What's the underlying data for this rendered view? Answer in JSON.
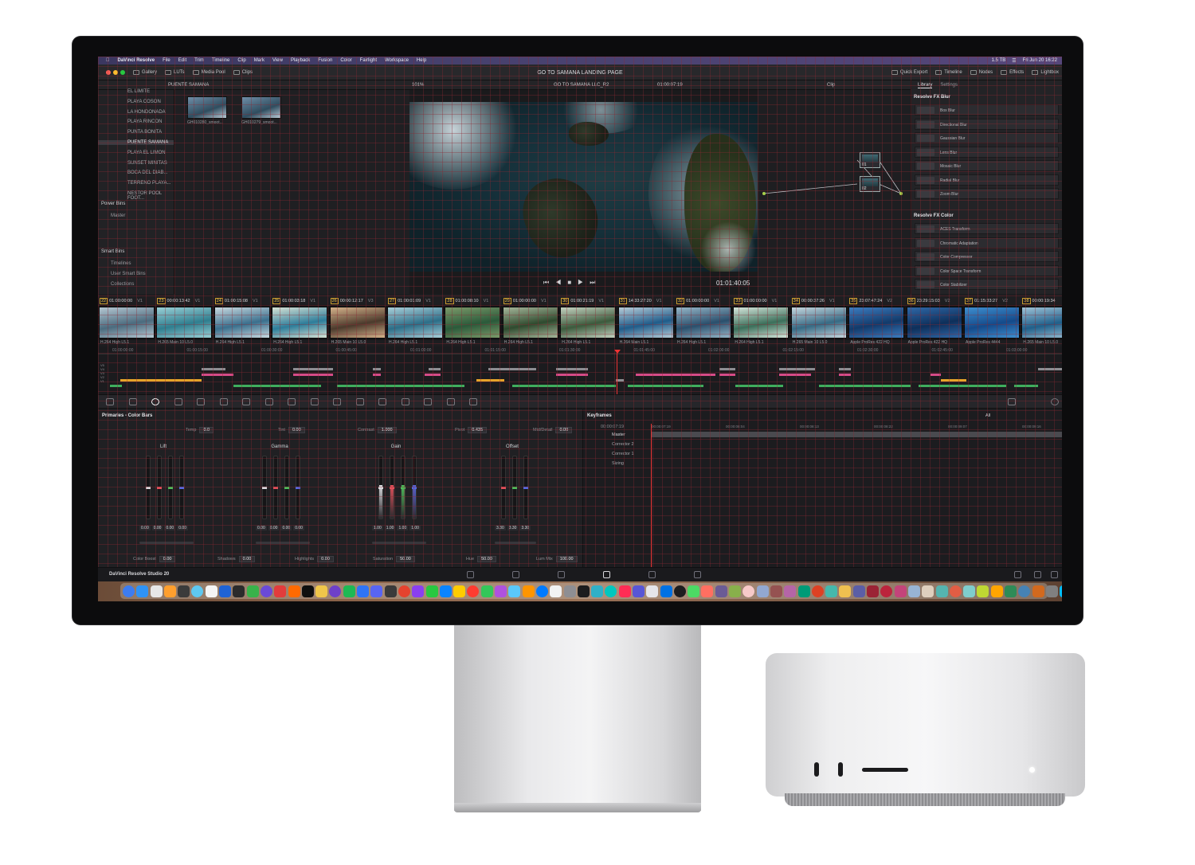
{
  "menubar": {
    "app": "DaVinci Resolve",
    "items": [
      "File",
      "Edit",
      "Trim",
      "Timeline",
      "Clip",
      "Mark",
      "View",
      "Playback",
      "Fusion",
      "Color",
      "Fairlight",
      "Workspace",
      "Help"
    ],
    "storage": "1.5 TB",
    "clock": "Fri Jun 20  16:22"
  },
  "toolbar": {
    "gallery": "Gallery",
    "luts": "LUTs",
    "media_pool": "Media Pool",
    "clips": "Clips",
    "project_title": "GO TO SAMANA LANDING PAGE",
    "quick_export": "Quick Export",
    "timeline": "Timeline",
    "nodes": "Nodes",
    "effects": "Effects",
    "lightbox": "Lightbox"
  },
  "subbar": {
    "bin_name": "PUENTE SAMANA",
    "zoom": "101%",
    "timeline_name": "GO TO SAMANA LLC_R2",
    "timecode": "01:00:07:19",
    "clip_mode": "Clip"
  },
  "mediapool": {
    "bins": [
      "EL LIMITE",
      "PLAYA COSON",
      "LA HONDONADA",
      "PLAYA RINCON",
      "PUNTA BONITA",
      "PUENTE SAMANA",
      "PLAYA EL LIMON",
      "SUNSET MINITAS",
      "BOCA DEL DIAB...",
      "TERRENO PLAYA...",
      "NESTOR POOL FOOT..."
    ],
    "selected_bin": "PUENTE SAMANA",
    "power_bins": "Power Bins",
    "master": "Master",
    "smart_bins": "Smart Bins",
    "smart_items": [
      "Timelines",
      "User Smart Bins",
      "Collections"
    ],
    "thumbs": [
      "GH010280_smoot...",
      "GH010279_smoot..."
    ]
  },
  "viewer": {
    "timecode": "01:01:40:05"
  },
  "nodes": [
    {
      "label": "01"
    },
    {
      "label": "02"
    }
  ],
  "library": {
    "tabs": [
      "Library",
      "Settings"
    ],
    "blur_header": "Resolve FX Blur",
    "blur_items": [
      "Box Blur",
      "Directional Blur",
      "Gaussian Blur",
      "Lens Blur",
      "Mosaic Blur",
      "Radial Blur",
      "Zoom Blur"
    ],
    "color_header": "Resolve FX Color",
    "color_items": [
      "ACES Transform",
      "Chromatic Adaptation",
      "Color Compressor",
      "Color Space Transform",
      "Color Stabilizer"
    ]
  },
  "clips": [
    {
      "num": "22",
      "tc": "01:00:00:00",
      "track": "V1",
      "codec": "H.264 High L5.1"
    },
    {
      "num": "23",
      "tc": "00:00:13:42",
      "track": "V1",
      "codec": "H.265 Main 10 L5.0"
    },
    {
      "num": "24",
      "tc": "01:00:15:08",
      "track": "V1",
      "codec": "H.264 High L5.1"
    },
    {
      "num": "25",
      "tc": "01:00:03:18",
      "track": "V1",
      "codec": "H.264 High L5.1"
    },
    {
      "num": "26",
      "tc": "00:00:12:17",
      "track": "V3",
      "codec": "H.265 Main 10 L5.0"
    },
    {
      "num": "27",
      "tc": "01:00:01:09",
      "track": "V1",
      "codec": "H.264 High L5.1"
    },
    {
      "num": "28",
      "tc": "01:00:08:10",
      "track": "V1",
      "codec": "H.264 High L5.1"
    },
    {
      "num": "29",
      "tc": "01:00:00:00",
      "track": "V1",
      "codec": "H.264 High L5.1"
    },
    {
      "num": "30",
      "tc": "01:00:21:19",
      "track": "V1",
      "codec": "H.264 High L5.1"
    },
    {
      "num": "31",
      "tc": "14:33:27:20",
      "track": "V1",
      "codec": "H.264 Main L5.1"
    },
    {
      "num": "32",
      "tc": "01:00:00:00",
      "track": "V1",
      "codec": "H.264 High L5.1"
    },
    {
      "num": "33",
      "tc": "01:00:00:00",
      "track": "V1",
      "codec": "H.264 High L5.1"
    },
    {
      "num": "34",
      "tc": "00:00:37:26",
      "track": "V1",
      "codec": "H.265 Main 10 L5.0"
    },
    {
      "num": "35",
      "tc": "23:07:47:24",
      "track": "V2",
      "codec": "Apple ProRes 422 HQ"
    },
    {
      "num": "36",
      "tc": "23:29:15:03",
      "track": "V2",
      "codec": "Apple ProRes 422 HQ"
    },
    {
      "num": "37",
      "tc": "01:15:33:27",
      "track": "V2",
      "codec": "Apple ProRes 4444"
    },
    {
      "num": "38",
      "tc": "00:00:19:34",
      "track": "",
      "codec": "H.265 Main 10 L5.0"
    }
  ],
  "ruler": [
    "01:00:00:00",
    "01:00:15:00",
    "01:00:30:00",
    "01:00:45:00",
    "01:01:00:00",
    "01:01:15:00",
    "01:01:30:00",
    "01:01:45:00",
    "01:02:00:00",
    "01:02:15:00",
    "01:02:30:00",
    "01:02:45:00",
    "01:03:00:00"
  ],
  "track_labels": [
    "V5",
    "V4",
    "V3",
    "V2",
    "V1"
  ],
  "primaries": {
    "title": "Primaries - Color Bars",
    "temp_label": "Temp",
    "temp": "0.0",
    "tint_label": "Tint",
    "tint": "0.00",
    "contrast_label": "Contrast",
    "contrast": "1.000",
    "pivot_label": "Pivot",
    "pivot": "0.435",
    "middetail_label": "Mid/Detail",
    "middetail": "0.00",
    "wheels": [
      {
        "name": "Lift",
        "values": [
          "0.00",
          "0.00",
          "0.00",
          "0.00"
        ]
      },
      {
        "name": "Gamma",
        "values": [
          "0.00",
          "0.00",
          "0.00",
          "0.00"
        ]
      },
      {
        "name": "Gain",
        "values": [
          "1.00",
          "1.00",
          "1.00",
          "1.00"
        ]
      },
      {
        "name": "Offset",
        "values": [
          "3.30",
          "3.30",
          "3.30"
        ]
      }
    ],
    "colorboost_label": "Color Boost",
    "colorboost": "0.00",
    "shadows_label": "Shadows",
    "shadows": "0.00",
    "highlights_label": "Highlights",
    "highlights": "0.00",
    "saturation_label": "Saturation",
    "saturation": "50.00",
    "hue_label": "Hue",
    "hue": "50.00",
    "lummix_label": "Lum Mix",
    "lummix": "100.00"
  },
  "keyframes": {
    "title": "Keyframes",
    "filter": "All",
    "timecode": "00:00:07:19",
    "ticks": [
      "00:00:07:19",
      "00:00:08:04",
      "00:00:08:13",
      "00:00:08:22",
      "00:00:09:07",
      "00:00:09:16"
    ],
    "rows": [
      "Master",
      "Corrector 2",
      "Corrector 1",
      "Sizing"
    ]
  },
  "pagebar": {
    "brand": "DaVinci Resolve Studio 20"
  },
  "colors": {
    "accent": "#e33a3a",
    "menubar": "#47416e",
    "clip_pink": "#d64b87",
    "clip_orange": "#e6a32a",
    "clip_green": "#3fae5d",
    "clip_gray": "#8d8d92"
  }
}
